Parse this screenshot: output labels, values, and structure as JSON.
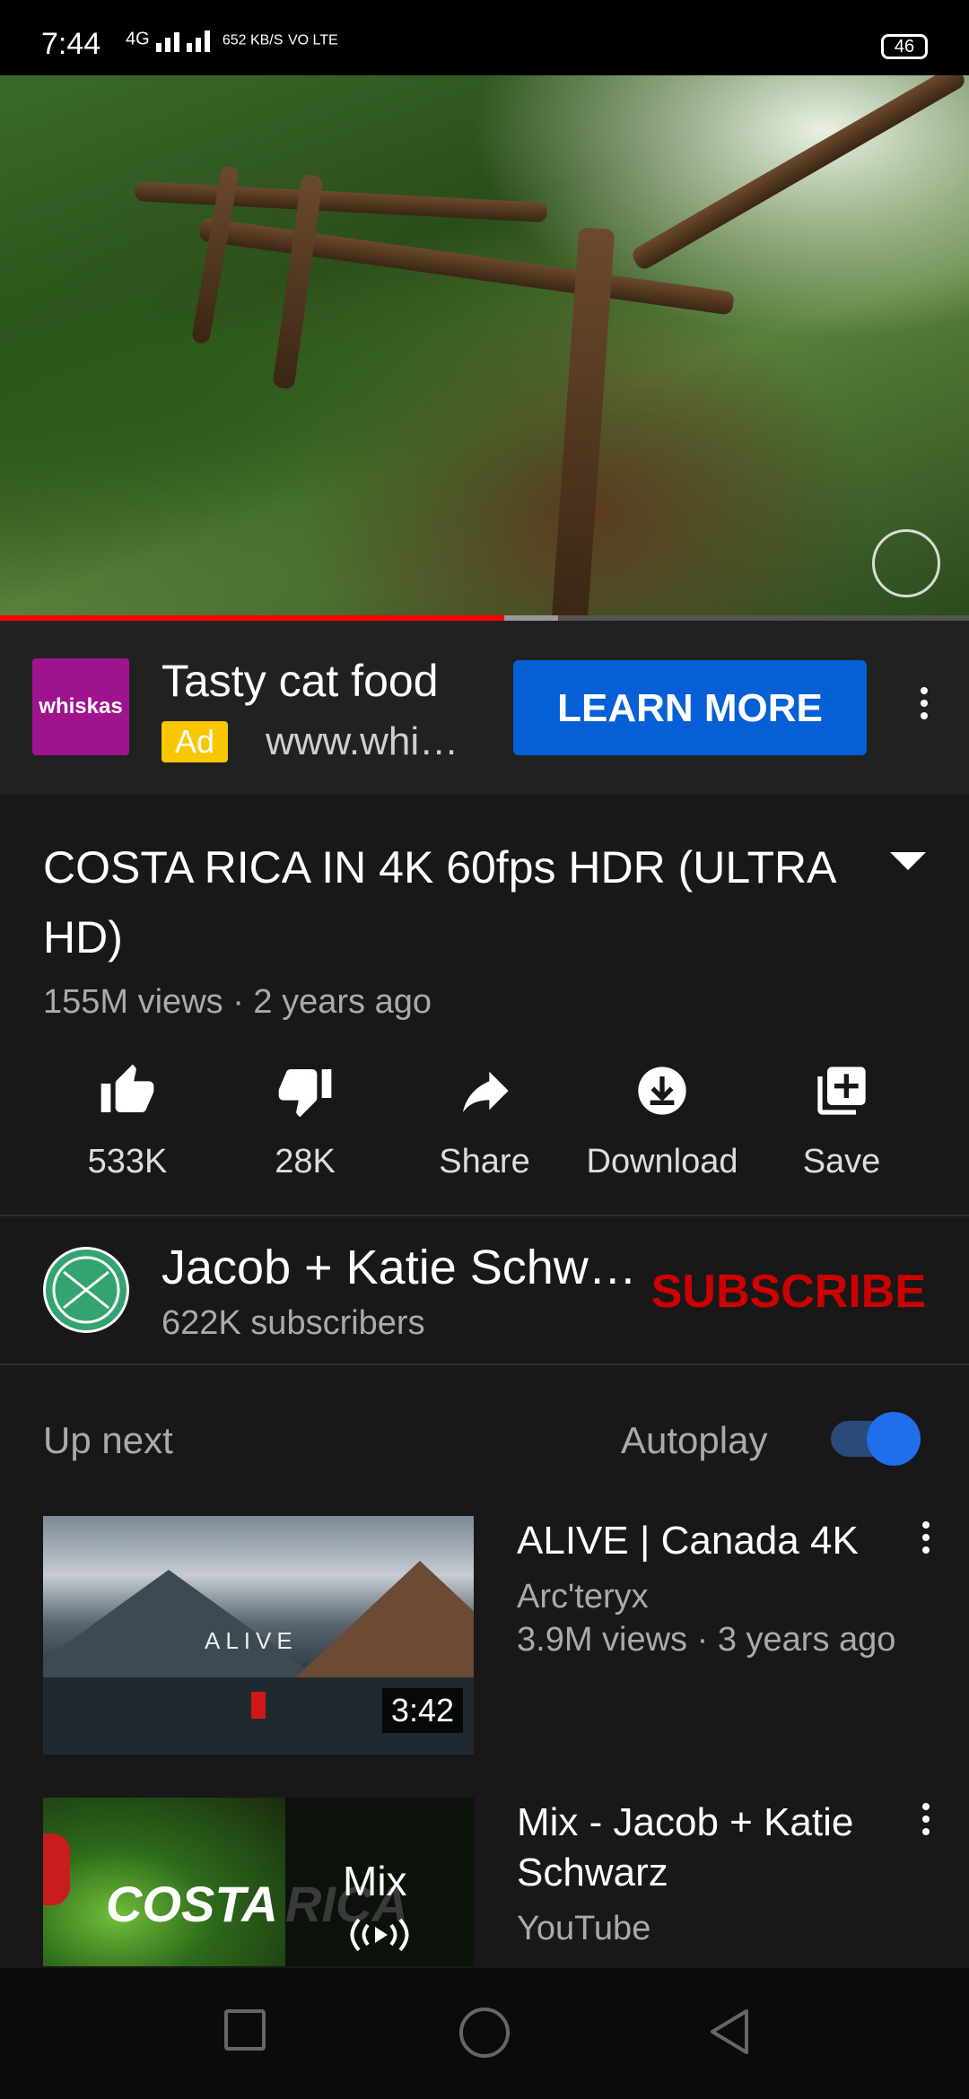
{
  "status_bar": {
    "time": "7:44",
    "network": "4G",
    "speed": "652 KB/S",
    "volte": "VO LTE",
    "battery": "46"
  },
  "player": {
    "progress_fraction": 0.52
  },
  "ad": {
    "logo_text": "whiskas",
    "title": "Tasty cat food",
    "badge": "Ad",
    "url": "www.whi…",
    "cta_label": "LEARN MORE"
  },
  "video": {
    "title": "COSTA RICA IN 4K 60fps HDR (ULTRA HD)",
    "meta": "155M views · 2 years ago",
    "actions": [
      {
        "label": "533K",
        "icon": "thumbs-up-icon"
      },
      {
        "label": "28K",
        "icon": "thumbs-down-icon"
      },
      {
        "label": "Share",
        "icon": "share-icon"
      },
      {
        "label": "Download",
        "icon": "download-icon"
      },
      {
        "label": "Save",
        "icon": "save-to-playlist-icon"
      }
    ]
  },
  "channel": {
    "name": "Jacob + Katie Schw…",
    "subscribers": "622K subscribers",
    "subscribe_label": "SUBSCRIBE"
  },
  "up_next": {
    "heading": "Up next",
    "autoplay_label": "Autoplay",
    "autoplay_on": true,
    "items": [
      {
        "title": "ALIVE | Canada 4K",
        "channel": "Arc'teryx",
        "meta": "3.9M views · 3 years ago",
        "duration": "3:42",
        "thumb_text": "ALIVE"
      },
      {
        "title": "Mix - Jacob + Katie Schwarz",
        "channel": "YouTube",
        "thumb_text": "COSTA",
        "thumb_text2": "RICA",
        "mix_label": "Mix"
      }
    ]
  },
  "colors": {
    "accent_red": "#cc0000",
    "cta_blue": "#065fd4",
    "progress_red": "#ff0000",
    "background": "#181818"
  }
}
